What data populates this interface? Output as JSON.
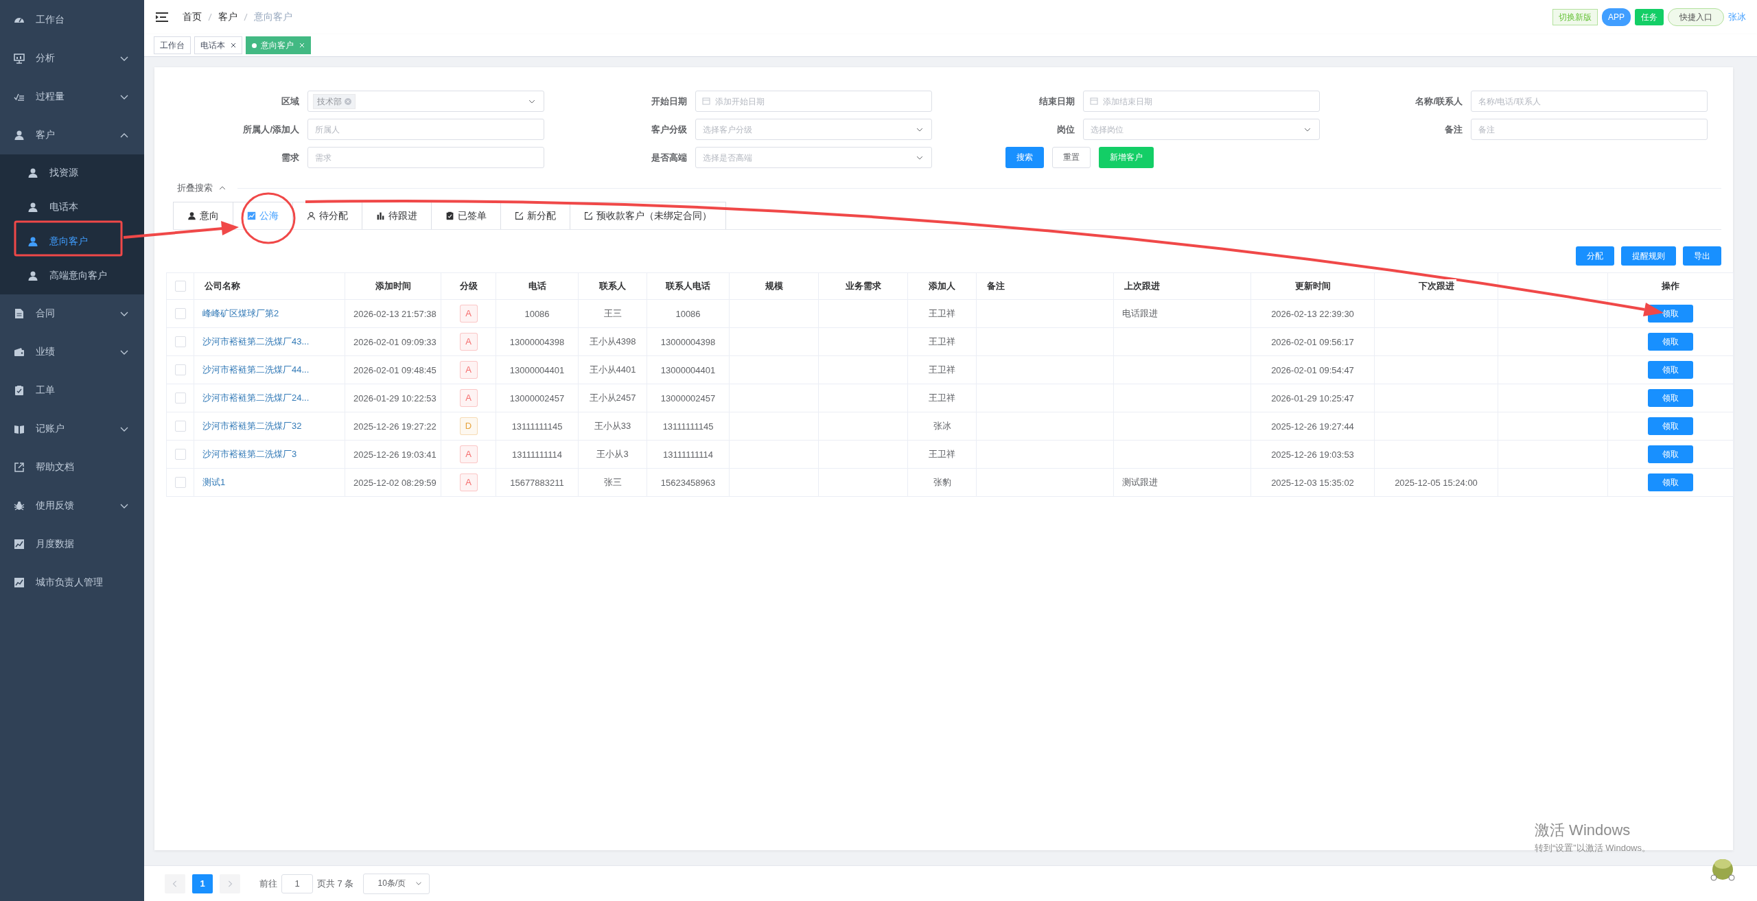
{
  "sidebar": {
    "items": [
      {
        "label": "工作台",
        "kind": "link"
      },
      {
        "label": "分析",
        "kind": "group",
        "expanded": false
      },
      {
        "label": "过程量",
        "kind": "group",
        "expanded": false
      },
      {
        "label": "客户",
        "kind": "group",
        "expanded": true,
        "children": [
          {
            "label": "找资源",
            "selected": false
          },
          {
            "label": "电话本",
            "selected": false
          },
          {
            "label": "意向客户",
            "selected": true
          },
          {
            "label": "高端意向客户",
            "selected": false
          }
        ]
      },
      {
        "label": "合同",
        "kind": "group",
        "expanded": false
      },
      {
        "label": "业绩",
        "kind": "group",
        "expanded": false
      },
      {
        "label": "工单",
        "kind": "link"
      },
      {
        "label": "记账户",
        "kind": "group",
        "expanded": false
      },
      {
        "label": "帮助文档",
        "kind": "link"
      },
      {
        "label": "使用反馈",
        "kind": "group",
        "expanded": false
      },
      {
        "label": "月度数据",
        "kind": "link"
      },
      {
        "label": "城市负责人管理",
        "kind": "link"
      }
    ]
  },
  "header": {
    "breadcrumb": [
      "首页",
      "客户",
      "意向客户"
    ],
    "actions": [
      {
        "label": "切换新版",
        "kind": "outline"
      },
      {
        "label": "APP",
        "kind": "info"
      },
      {
        "label": "任务",
        "kind": "success"
      },
      {
        "label": "快捷入口",
        "kind": "soft"
      }
    ],
    "user": "张冰"
  },
  "tags_view": [
    {
      "label": "工作台",
      "closable": false,
      "selected": false
    },
    {
      "label": "电话本",
      "closable": true,
      "selected": false
    },
    {
      "label": "意向客户",
      "closable": true,
      "selected": true
    }
  ],
  "search_form": {
    "fields": [
      {
        "label": "区域",
        "kind": "select",
        "tags": [
          "技术部"
        ]
      },
      {
        "label": "开始日期",
        "kind": "date",
        "placeholder": "添加开始日期"
      },
      {
        "label": "结束日期",
        "kind": "date",
        "placeholder": "添加结束日期"
      },
      {
        "label": "名称/联系人",
        "kind": "input",
        "placeholder": "名称/电话/联系人"
      },
      {
        "label": "所属人/添加人",
        "kind": "input",
        "placeholder": "所属人"
      },
      {
        "label": "客户分级",
        "kind": "select",
        "placeholder": "选择客户分级"
      },
      {
        "label": "岗位",
        "kind": "select",
        "placeholder": "选择岗位"
      },
      {
        "label": "备注",
        "kind": "input",
        "placeholder": "备注"
      },
      {
        "label": "需求",
        "kind": "input",
        "placeholder": "需求"
      },
      {
        "label": "是否高端",
        "kind": "select",
        "placeholder": "选择是否高端"
      }
    ],
    "buttons": [
      {
        "label": "搜索",
        "kind": "primary"
      },
      {
        "label": "重置",
        "kind": "default"
      },
      {
        "label": "新增客户",
        "kind": "success"
      }
    ],
    "collapse": {
      "label": "折叠搜索",
      "expanded": true
    }
  },
  "tabs": [
    {
      "label": "意向",
      "selected": false
    },
    {
      "label": "公海",
      "selected": true
    },
    {
      "label": "待分配",
      "selected": false
    },
    {
      "label": "待跟进",
      "selected": false
    },
    {
      "label": "已签单",
      "selected": false
    },
    {
      "label": "新分配",
      "selected": false
    },
    {
      "label": "预收款客户（未绑定合同）",
      "selected": false
    }
  ],
  "toolbar": [
    "分配",
    "提醒规则",
    "导出"
  ],
  "table": {
    "select_all": false,
    "columns": [
      {
        "label": "公司名称",
        "kind": "text"
      },
      {
        "label": "添加时间",
        "kind": "text"
      },
      {
        "label": "分级",
        "kind": "text"
      },
      {
        "label": "电话",
        "kind": "text"
      },
      {
        "label": "联系人",
        "kind": "text"
      },
      {
        "label": "联系人电话",
        "kind": "text"
      },
      {
        "label": "规模",
        "kind": "text"
      },
      {
        "label": "业务需求",
        "kind": "text"
      },
      {
        "label": "添加人",
        "kind": "text"
      },
      {
        "label": "备注",
        "kind": "text"
      },
      {
        "label": "上次跟进",
        "kind": "text"
      },
      {
        "label": "更新时间",
        "kind": "text"
      },
      {
        "label": "下次跟进",
        "kind": "text"
      },
      {
        "kind": "blank"
      },
      {
        "label": "操作",
        "kind": "text"
      }
    ],
    "rows": [
      {
        "checked": false,
        "company": "峰峰矿区煤球厂第2",
        "added_at": "2026-02-13 21:57:38",
        "grade": {
          "text": "A",
          "color": "#f56c6c"
        },
        "phone": "10086",
        "contact": "王三",
        "contact_phone": "10086",
        "adder": "王卫祥",
        "last_follow_up": "电话跟进",
        "updated_at": "2026-02-13 22:39:30",
        "action": "领取"
      },
      {
        "checked": false,
        "company": "沙河市褡裢第二洗煤厂43...",
        "added_at": "2026-02-01 09:09:33",
        "grade": {
          "text": "A",
          "color": "#f56c6c"
        },
        "phone": "13000004398",
        "contact": "王小从4398",
        "contact_phone": "13000004398",
        "adder": "王卫祥",
        "updated_at": "2026-02-01 09:56:17",
        "action": "领取"
      },
      {
        "checked": false,
        "company": "沙河市褡裢第二洗煤厂44...",
        "added_at": "2026-02-01 09:48:45",
        "grade": {
          "text": "A",
          "color": "#f56c6c"
        },
        "phone": "13000004401",
        "contact": "王小从4401",
        "contact_phone": "13000004401",
        "adder": "王卫祥",
        "updated_at": "2026-02-01 09:54:47",
        "action": "领取"
      },
      {
        "checked": false,
        "company": "沙河市褡裢第二洗煤厂24...",
        "added_at": "2026-01-29 10:22:53",
        "grade": {
          "text": "A",
          "color": "#f56c6c"
        },
        "phone": "13000002457",
        "contact": "王小从2457",
        "contact_phone": "13000002457",
        "adder": "王卫祥",
        "updated_at": "2026-01-29 10:25:47",
        "action": "领取"
      },
      {
        "checked": false,
        "company": "沙河市褡裢第二洗煤厂32",
        "added_at": "2025-12-26 19:27:22",
        "grade": {
          "text": "D",
          "color": "#e6a23c"
        },
        "phone": "13111111145",
        "contact": "王小从33",
        "contact_phone": "13111111145",
        "adder": "张冰",
        "updated_at": "2025-12-26 19:27:44",
        "action": "领取"
      },
      {
        "checked": false,
        "company": "沙河市褡裢第二洗煤厂3",
        "added_at": "2025-12-26 19:03:41",
        "grade": {
          "text": "A",
          "color": "#f56c6c"
        },
        "phone": "13111111114",
        "contact": "王小从3",
        "contact_phone": "13111111114",
        "adder": "王卫祥",
        "updated_at": "2025-12-26 19:03:53",
        "action": "领取"
      },
      {
        "checked": false,
        "company": "测试1",
        "added_at": "2025-12-02 08:29:59",
        "grade": {
          "text": "A",
          "color": "#f56c6c"
        },
        "phone": "15677883211",
        "contact": "张三",
        "contact_phone": "15623458963",
        "adder": "张豹",
        "last_follow_up": "测试跟进",
        "updated_at": "2025-12-03 15:35:02",
        "next_follow_up": "2025-12-05 15:24:00",
        "action": "领取"
      }
    ]
  },
  "pagination": {
    "pages": [
      {
        "label": "1",
        "selected": true
      }
    ],
    "goto_label": "前往",
    "goto_value": "1",
    "total": "页共 7 条",
    "page_size": "10条/页"
  },
  "os_notice": {
    "title": "激活 Windows",
    "text": "转到“设置”以激活 Windows。"
  }
}
